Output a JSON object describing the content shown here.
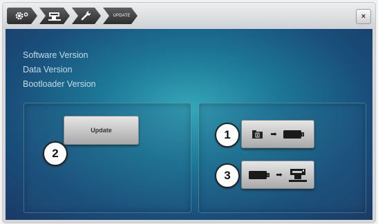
{
  "breadcrumb": {
    "items": [
      {
        "icon": "gear-icon"
      },
      {
        "icon": "sewing-machine-icon"
      },
      {
        "icon": "wrench-icon"
      },
      {
        "label": "UPDATE"
      }
    ]
  },
  "close_icon": "close-icon",
  "close_label": "×",
  "info": {
    "software_version_label": "Software Version",
    "data_version_label": "Data Version",
    "bootloader_version_label": "Bootloader Version"
  },
  "update_panel": {
    "update_button_label": "Update",
    "callout": "2"
  },
  "transfer_panel": {
    "export_callout": "1",
    "import_callout": "3",
    "export_icons": [
      "machine-memory-icon",
      "arrow-right-icon",
      "usb-stick-icon"
    ],
    "import_icons": [
      "usb-stick-icon",
      "arrow-right-icon",
      "sewing-machine-icon"
    ],
    "arrow_glyph": "➡"
  },
  "colors": {
    "screen_center": "#35a7b8",
    "screen_edge": "#1a3a66",
    "info_text": "#c6dde6",
    "crumb_bg": "#2c2c2c"
  }
}
